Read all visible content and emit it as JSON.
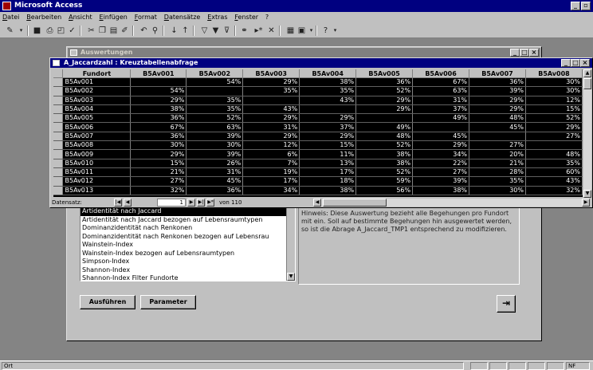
{
  "app": {
    "title": "Microsoft Access"
  },
  "menu": [
    "Datei",
    "Bearbeiten",
    "Ansicht",
    "Einfügen",
    "Format",
    "Datensätze",
    "Extras",
    "Fenster",
    "?"
  ],
  "form": {
    "title": "Auswertungen",
    "list_items": [
      "Artidentität nach Jaccard",
      "Artidentität nach Jaccard bezogen auf Lebensraumtypen",
      "Dominanzidentität nach Renkonen",
      "Dominanzidentität nach Renkonen bezogen auf Lebensrau",
      "Wainstein-Index",
      "Wainstein-Index bezogen auf Lebensraumtypen",
      "Simpson-Index",
      "Shannon-Index",
      "Shannon-Index Filter Fundorte"
    ],
    "selected_index": 0,
    "hint": "Hinweis: Diese Auswertung bezieht alle Begehungen pro Fundort mit ein. Soll auf bestimmte Begehungen hin ausgewertet werden, so ist die Abrage A_Jaccard_TMP1 entsprechend zu modifizieren.",
    "run_label": "Ausführen",
    "param_label": "Parameter"
  },
  "query": {
    "title": "A_Jaccardzahl : Kreuztabellenabfrage",
    "columns": [
      "Fundort",
      "B5Av001",
      "B5Av002",
      "B5Av003",
      "B5Av004",
      "B5Av005",
      "B5Av006",
      "B5Av007",
      "B5Av008"
    ],
    "rows": [
      [
        "B5Av001",
        "",
        "54%",
        "29%",
        "38%",
        "36%",
        "67%",
        "36%",
        "30%"
      ],
      [
        "B5Av002",
        "54%",
        "",
        "35%",
        "35%",
        "52%",
        "63%",
        "39%",
        "30%"
      ],
      [
        "B5Av003",
        "29%",
        "35%",
        "",
        "43%",
        "29%",
        "31%",
        "29%",
        "12%"
      ],
      [
        "B5Av004",
        "38%",
        "35%",
        "43%",
        "",
        "29%",
        "37%",
        "29%",
        "15%"
      ],
      [
        "B5Av005",
        "36%",
        "52%",
        "29%",
        "29%",
        "",
        "49%",
        "48%",
        "52%"
      ],
      [
        "B5Av006",
        "67%",
        "63%",
        "31%",
        "37%",
        "49%",
        "",
        "45%",
        "29%"
      ],
      [
        "B5Av007",
        "36%",
        "39%",
        "29%",
        "29%",
        "48%",
        "45%",
        "",
        "27%"
      ],
      [
        "B5Av008",
        "30%",
        "30%",
        "12%",
        "15%",
        "52%",
        "29%",
        "27%",
        ""
      ],
      [
        "B5Av009",
        "29%",
        "39%",
        "6%",
        "11%",
        "38%",
        "34%",
        "20%",
        "48%"
      ],
      [
        "B5Av010",
        "15%",
        "26%",
        "7%",
        "13%",
        "38%",
        "22%",
        "21%",
        "35%"
      ],
      [
        "B5Av011",
        "21%",
        "31%",
        "19%",
        "17%",
        "52%",
        "27%",
        "28%",
        "60%"
      ],
      [
        "B5Av012",
        "27%",
        "45%",
        "17%",
        "18%",
        "59%",
        "39%",
        "35%",
        "43%"
      ],
      [
        "B5Av013",
        "32%",
        "36%",
        "34%",
        "38%",
        "56%",
        "38%",
        "30%",
        "32%"
      ]
    ],
    "nav": {
      "label": "Datensatz:",
      "current": "1",
      "total_label": "von 110"
    }
  },
  "status": {
    "left": "Ort",
    "nf": "NF"
  }
}
